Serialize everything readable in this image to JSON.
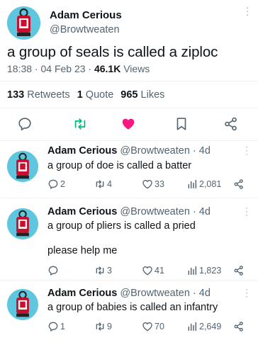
{
  "main": {
    "name": "Adam Cerious",
    "handle": "@Browtweaten",
    "text": "a group of seals is called a ziploc",
    "time": "18:38 · 04 Feb 23 · ",
    "views_count": "46.1K",
    "views_label": " Views",
    "retweets_count": "133",
    "retweets_label": " Retweets",
    "quotes_count": "1",
    "quotes_label": " Quote",
    "likes_count": "965",
    "likes_label": " Likes",
    "liked": true,
    "colors": {
      "like": "#f91880",
      "retweet": "#00ba7c",
      "icon": "#536471"
    },
    "icons": [
      "reply-icon",
      "retweet-icon",
      "like-icon",
      "bookmark-icon",
      "share-icon"
    ]
  },
  "replies": [
    {
      "name": "Adam Cerious",
      "handle": "@Browtweaten",
      "time": "· 4d",
      "text": "a group of doe is called a batter",
      "text2": "",
      "replies": "2",
      "retweets": "4",
      "likes": "33",
      "views": "2,081"
    },
    {
      "name": "Adam Cerious",
      "handle": "@Browtweaten",
      "time": "· 4d",
      "text": "a group of pliers is called a pried",
      "text2": "please help me",
      "replies": "",
      "retweets": "3",
      "likes": "41",
      "views": "1,823"
    },
    {
      "name": "Adam Cerious",
      "handle": "@Browtweaten",
      "time": "· 4d",
      "text": "a group of babies is called an infantry",
      "text2": "",
      "replies": "1",
      "retweets": "9",
      "likes": "70",
      "views": "2,649"
    }
  ]
}
